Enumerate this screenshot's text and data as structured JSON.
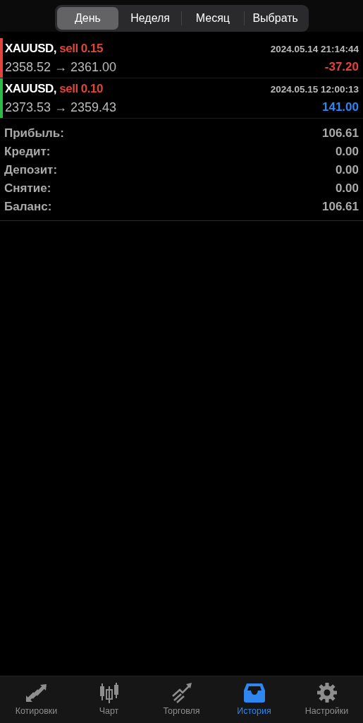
{
  "periods": [
    {
      "label": "День",
      "selected": true
    },
    {
      "label": "Неделя",
      "selected": false
    },
    {
      "label": "Месяц",
      "selected": false
    },
    {
      "label": "Выбрать",
      "selected": false
    }
  ],
  "deals": [
    {
      "symbol": "XAUUSD,",
      "side": "sell 0.15",
      "time": "2024.05.14 21:14:44",
      "prices": "2358.52 → 2361.00",
      "profit": "-37.20",
      "color": "#e0443a"
    },
    {
      "symbol": "XAUUSD,",
      "side": "sell 0.10",
      "time": "2024.05.15 12:00:13",
      "prices": "2373.53 → 2359.43",
      "profit": "141.00",
      "color": "#2fb84a"
    }
  ],
  "summary": [
    {
      "label": "Прибыль:",
      "value": "106.61"
    },
    {
      "label": "Кредит:",
      "value": "0.00"
    },
    {
      "label": "Депозит:",
      "value": "0.00"
    },
    {
      "label": "Снятие:",
      "value": "0.00"
    },
    {
      "label": "Баланс:",
      "value": "106.61"
    }
  ],
  "tabbar": [
    {
      "kind": "quotes",
      "label": "Котировки",
      "selected": false
    },
    {
      "kind": "chart",
      "label": "Чарт",
      "selected": false
    },
    {
      "kind": "trade",
      "label": "Торговля",
      "selected": false
    },
    {
      "kind": "history",
      "label": "История",
      "selected": true
    },
    {
      "kind": "settings",
      "label": "Настройки",
      "selected": false
    }
  ]
}
